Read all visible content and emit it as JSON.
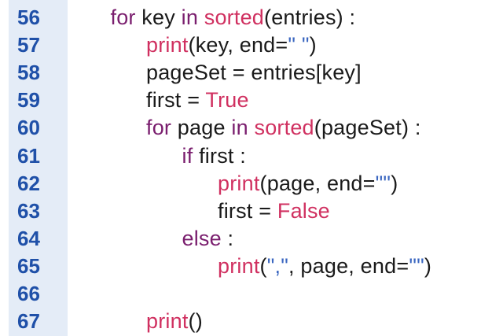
{
  "colors": {
    "line_number": "#1f50a8",
    "keyword": "#7a1e6e",
    "builtin": "#d03060",
    "string": "#3a66c0",
    "plain": "#1a1a1a",
    "gutter_bg": "#e4ecf7"
  },
  "lines": [
    {
      "num": "56",
      "indent": 1,
      "tokens": [
        {
          "t": "for",
          "c": "kw"
        },
        {
          "t": " key ",
          "c": "pl"
        },
        {
          "t": "in",
          "c": "kw"
        },
        {
          "t": " ",
          "c": "pl"
        },
        {
          "t": "sorted",
          "c": "fn"
        },
        {
          "t": "(entries) :",
          "c": "pl"
        }
      ]
    },
    {
      "num": "57",
      "indent": 2,
      "tokens": [
        {
          "t": "print",
          "c": "fn"
        },
        {
          "t": "(key, end=",
          "c": "pl"
        },
        {
          "t": "\" \"",
          "c": "st"
        },
        {
          "t": ")",
          "c": "pl"
        }
      ]
    },
    {
      "num": "58",
      "indent": 2,
      "tokens": [
        {
          "t": "pageSet = entries[key]",
          "c": "pl"
        }
      ]
    },
    {
      "num": "59",
      "indent": 2,
      "tokens": [
        {
          "t": "first = ",
          "c": "pl"
        },
        {
          "t": "True",
          "c": "fn"
        }
      ]
    },
    {
      "num": "60",
      "indent": 2,
      "tokens": [
        {
          "t": "for",
          "c": "kw"
        },
        {
          "t": " page ",
          "c": "pl"
        },
        {
          "t": "in",
          "c": "kw"
        },
        {
          "t": " ",
          "c": "pl"
        },
        {
          "t": "sorted",
          "c": "fn"
        },
        {
          "t": "(pageSet) :",
          "c": "pl"
        }
      ]
    },
    {
      "num": "61",
      "indent": 3,
      "tokens": [
        {
          "t": "if",
          "c": "kw"
        },
        {
          "t": " first :",
          "c": "pl"
        }
      ]
    },
    {
      "num": "62",
      "indent": 4,
      "tokens": [
        {
          "t": "print",
          "c": "fn"
        },
        {
          "t": "(page, end=",
          "c": "pl"
        },
        {
          "t": "\"\"",
          "c": "st"
        },
        {
          "t": ")",
          "c": "pl"
        }
      ]
    },
    {
      "num": "63",
      "indent": 4,
      "tokens": [
        {
          "t": "first = ",
          "c": "pl"
        },
        {
          "t": "False",
          "c": "fn"
        }
      ]
    },
    {
      "num": "64",
      "indent": 3,
      "tokens": [
        {
          "t": "else",
          "c": "kw"
        },
        {
          "t": " :",
          "c": "pl"
        }
      ]
    },
    {
      "num": "65",
      "indent": 4,
      "tokens": [
        {
          "t": "print",
          "c": "fn"
        },
        {
          "t": "(",
          "c": "pl"
        },
        {
          "t": "\",\"",
          "c": "st"
        },
        {
          "t": ", page, end=",
          "c": "pl"
        },
        {
          "t": "\"\"",
          "c": "st"
        },
        {
          "t": ")",
          "c": "pl"
        }
      ]
    },
    {
      "num": "66",
      "indent": 0,
      "tokens": []
    },
    {
      "num": "67",
      "indent": 2,
      "tokens": [
        {
          "t": "print",
          "c": "fn"
        },
        {
          "t": "()",
          "c": "pl"
        }
      ]
    }
  ]
}
